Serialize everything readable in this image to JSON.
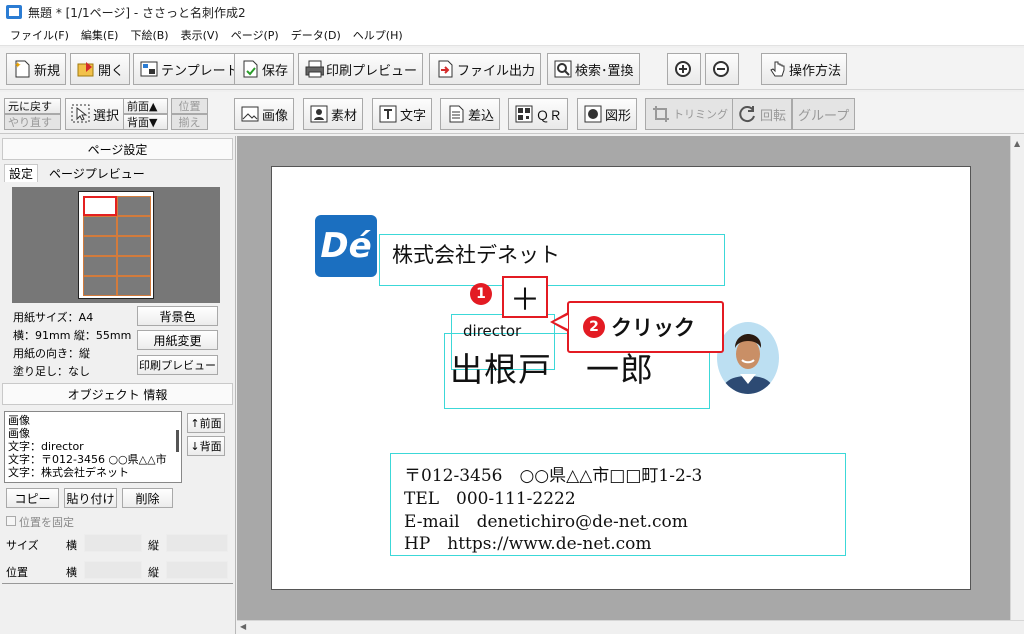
{
  "window": {
    "title": "無題 * [1/1ページ] - ささっと名刺作成2"
  },
  "menu": [
    "ファイル(F)",
    "編集(E)",
    "下絵(B)",
    "表示(V)",
    "ページ(P)",
    "データ(D)",
    "ヘルプ(H)"
  ],
  "toolbar1": {
    "new": "新規",
    "open": "開く",
    "template": "テンプレート",
    "save": "保存",
    "print_preview": "印刷プレビュー",
    "file_output": "ファイル出力",
    "search_replace": "検索･置換",
    "help": "操作方法"
  },
  "toolbar2": {
    "undo": "元に戻す",
    "redo": "やり直す",
    "select": "選択",
    "front": "前面▲",
    "back": "背面▼",
    "align1": "位置",
    "align2": "揃え",
    "image": "画像",
    "material": "素材",
    "text": "文字",
    "merge": "差込",
    "qr": "ＱＲ",
    "shape": "図形",
    "trim": "トリミング",
    "rotate": "回転",
    "group": "グループ"
  },
  "left": {
    "page_settings": "ページ設定",
    "tab_settings": "設定",
    "tab_preview": "ページプレビュー",
    "paper_size": "用紙サイズ：A4",
    "dimensions": "横：91mm  縦：55mm",
    "orientation": "用紙の向き：縦",
    "bleed": "塗り足し：なし",
    "btn_bgcolor": "背景色",
    "btn_change_paper": "用紙変更",
    "btn_print_preview": "印刷プレビュー",
    "object_info": "オブジェクト 情報",
    "objects": [
      "画像",
      "画像",
      "文字：director",
      "文字：〒012-3456 ○○県△△市",
      "文字：株式会社デネット"
    ],
    "btn_front": "↑前面",
    "btn_back": "↓背面",
    "btn_copy": "コピー",
    "btn_paste": "貼り付け",
    "btn_delete": "削除",
    "fix_position": "位置を固定",
    "size": "サイズ",
    "position": "位置",
    "width": "横",
    "height": "縦"
  },
  "card": {
    "logo": "Dé",
    "company": "株式会社デネット",
    "title": "director",
    "name": "出根戸　一郎",
    "address": "〒012-3456　○○県△△市□□町1-2-3",
    "tel": "TEL　000-111-2222",
    "email": "E-mail　denetichiro@de-net.com",
    "hp": "HP　https://www.de-net.com"
  },
  "annotations": {
    "step1_badge": "1",
    "step1_symbol": "＋",
    "step2_badge": "2",
    "step2_text": "クリック",
    "accent": "#e31b23"
  }
}
